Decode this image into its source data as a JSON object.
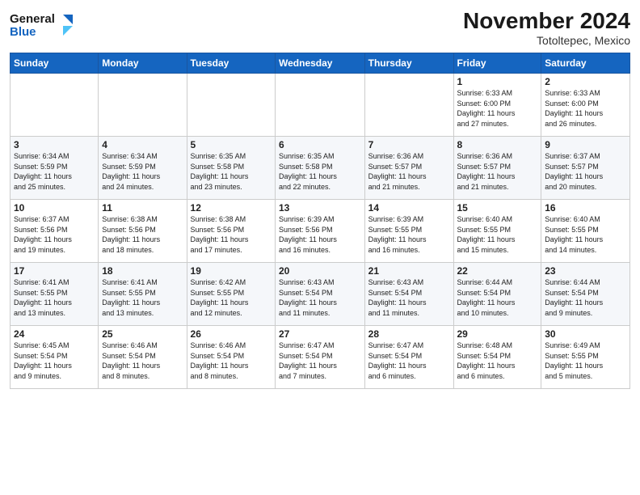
{
  "logo": {
    "line1": "General",
    "line2": "Blue"
  },
  "title": "November 2024",
  "subtitle": "Totoltepec, Mexico",
  "weekdays": [
    "Sunday",
    "Monday",
    "Tuesday",
    "Wednesday",
    "Thursday",
    "Friday",
    "Saturday"
  ],
  "weeks": [
    [
      {
        "day": "",
        "info": ""
      },
      {
        "day": "",
        "info": ""
      },
      {
        "day": "",
        "info": ""
      },
      {
        "day": "",
        "info": ""
      },
      {
        "day": "",
        "info": ""
      },
      {
        "day": "1",
        "info": "Sunrise: 6:33 AM\nSunset: 6:00 PM\nDaylight: 11 hours\nand 27 minutes."
      },
      {
        "day": "2",
        "info": "Sunrise: 6:33 AM\nSunset: 6:00 PM\nDaylight: 11 hours\nand 26 minutes."
      }
    ],
    [
      {
        "day": "3",
        "info": "Sunrise: 6:34 AM\nSunset: 5:59 PM\nDaylight: 11 hours\nand 25 minutes."
      },
      {
        "day": "4",
        "info": "Sunrise: 6:34 AM\nSunset: 5:59 PM\nDaylight: 11 hours\nand 24 minutes."
      },
      {
        "day": "5",
        "info": "Sunrise: 6:35 AM\nSunset: 5:58 PM\nDaylight: 11 hours\nand 23 minutes."
      },
      {
        "day": "6",
        "info": "Sunrise: 6:35 AM\nSunset: 5:58 PM\nDaylight: 11 hours\nand 22 minutes."
      },
      {
        "day": "7",
        "info": "Sunrise: 6:36 AM\nSunset: 5:57 PM\nDaylight: 11 hours\nand 21 minutes."
      },
      {
        "day": "8",
        "info": "Sunrise: 6:36 AM\nSunset: 5:57 PM\nDaylight: 11 hours\nand 21 minutes."
      },
      {
        "day": "9",
        "info": "Sunrise: 6:37 AM\nSunset: 5:57 PM\nDaylight: 11 hours\nand 20 minutes."
      }
    ],
    [
      {
        "day": "10",
        "info": "Sunrise: 6:37 AM\nSunset: 5:56 PM\nDaylight: 11 hours\nand 19 minutes."
      },
      {
        "day": "11",
        "info": "Sunrise: 6:38 AM\nSunset: 5:56 PM\nDaylight: 11 hours\nand 18 minutes."
      },
      {
        "day": "12",
        "info": "Sunrise: 6:38 AM\nSunset: 5:56 PM\nDaylight: 11 hours\nand 17 minutes."
      },
      {
        "day": "13",
        "info": "Sunrise: 6:39 AM\nSunset: 5:56 PM\nDaylight: 11 hours\nand 16 minutes."
      },
      {
        "day": "14",
        "info": "Sunrise: 6:39 AM\nSunset: 5:55 PM\nDaylight: 11 hours\nand 16 minutes."
      },
      {
        "day": "15",
        "info": "Sunrise: 6:40 AM\nSunset: 5:55 PM\nDaylight: 11 hours\nand 15 minutes."
      },
      {
        "day": "16",
        "info": "Sunrise: 6:40 AM\nSunset: 5:55 PM\nDaylight: 11 hours\nand 14 minutes."
      }
    ],
    [
      {
        "day": "17",
        "info": "Sunrise: 6:41 AM\nSunset: 5:55 PM\nDaylight: 11 hours\nand 13 minutes."
      },
      {
        "day": "18",
        "info": "Sunrise: 6:41 AM\nSunset: 5:55 PM\nDaylight: 11 hours\nand 13 minutes."
      },
      {
        "day": "19",
        "info": "Sunrise: 6:42 AM\nSunset: 5:55 PM\nDaylight: 11 hours\nand 12 minutes."
      },
      {
        "day": "20",
        "info": "Sunrise: 6:43 AM\nSunset: 5:54 PM\nDaylight: 11 hours\nand 11 minutes."
      },
      {
        "day": "21",
        "info": "Sunrise: 6:43 AM\nSunset: 5:54 PM\nDaylight: 11 hours\nand 11 minutes."
      },
      {
        "day": "22",
        "info": "Sunrise: 6:44 AM\nSunset: 5:54 PM\nDaylight: 11 hours\nand 10 minutes."
      },
      {
        "day": "23",
        "info": "Sunrise: 6:44 AM\nSunset: 5:54 PM\nDaylight: 11 hours\nand 9 minutes."
      }
    ],
    [
      {
        "day": "24",
        "info": "Sunrise: 6:45 AM\nSunset: 5:54 PM\nDaylight: 11 hours\nand 9 minutes."
      },
      {
        "day": "25",
        "info": "Sunrise: 6:46 AM\nSunset: 5:54 PM\nDaylight: 11 hours\nand 8 minutes."
      },
      {
        "day": "26",
        "info": "Sunrise: 6:46 AM\nSunset: 5:54 PM\nDaylight: 11 hours\nand 8 minutes."
      },
      {
        "day": "27",
        "info": "Sunrise: 6:47 AM\nSunset: 5:54 PM\nDaylight: 11 hours\nand 7 minutes."
      },
      {
        "day": "28",
        "info": "Sunrise: 6:47 AM\nSunset: 5:54 PM\nDaylight: 11 hours\nand 6 minutes."
      },
      {
        "day": "29",
        "info": "Sunrise: 6:48 AM\nSunset: 5:54 PM\nDaylight: 11 hours\nand 6 minutes."
      },
      {
        "day": "30",
        "info": "Sunrise: 6:49 AM\nSunset: 5:55 PM\nDaylight: 11 hours\nand 5 minutes."
      }
    ]
  ]
}
